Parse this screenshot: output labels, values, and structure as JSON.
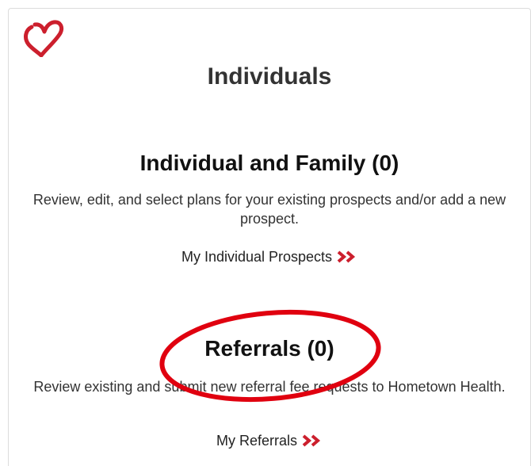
{
  "page": {
    "title": "Individuals"
  },
  "sections": [
    {
      "title": "Individual and Family (0)",
      "description": "Review, edit, and select plans for your existing prospects and/or add a new prospect.",
      "link": "My Individual Prospects"
    },
    {
      "title": "Referrals (0)",
      "description": "Review existing and submit new referral fee requests to Hometown Health.",
      "link": "My Referrals"
    }
  ],
  "colors": {
    "brand_red": "#cc1f2d",
    "annotation_red": "#e0000f"
  },
  "icons": {
    "logo": "heart-logo-icon",
    "link_arrow": "double-chevron-right-icon"
  }
}
